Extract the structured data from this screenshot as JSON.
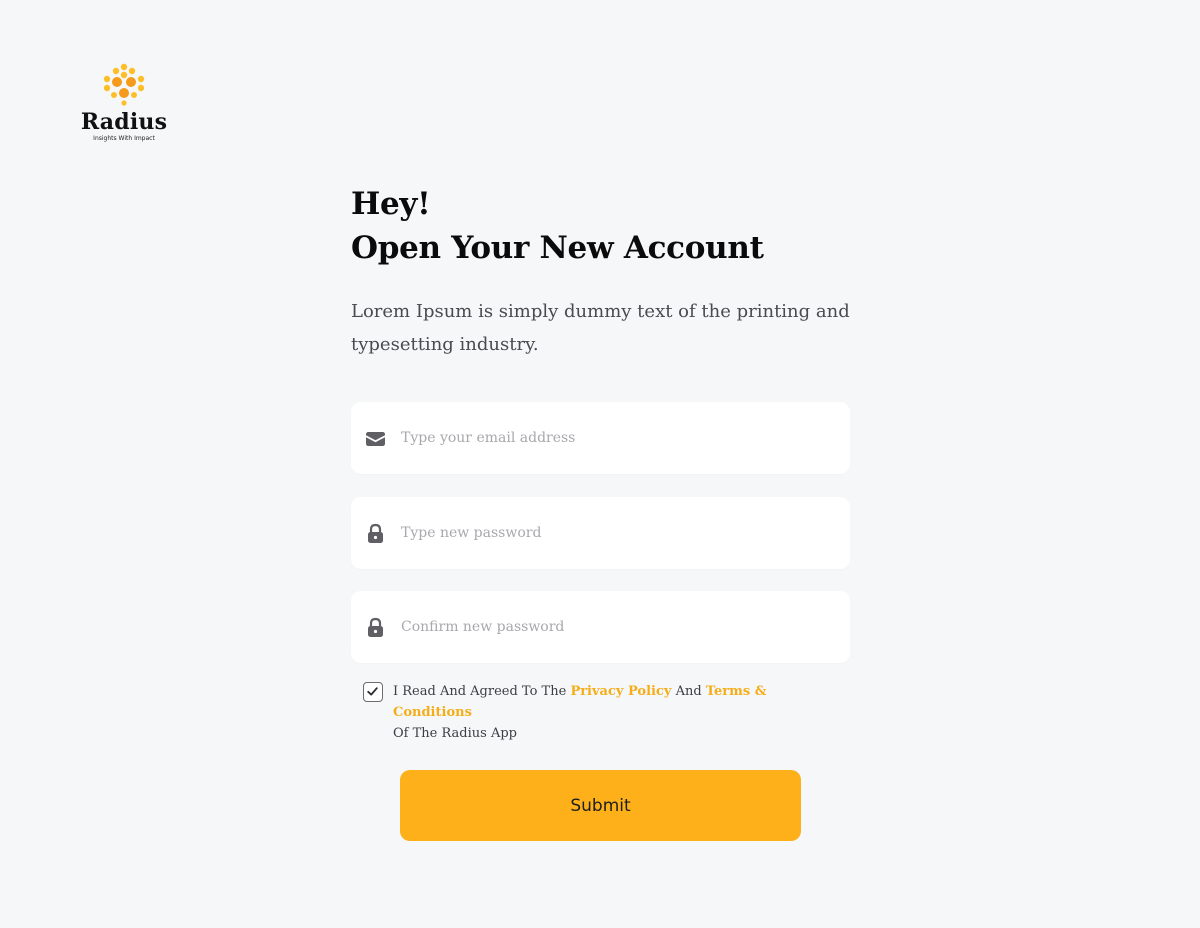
{
  "brand": {
    "name": "Radius",
    "tagline": "Insights With Impact",
    "color": "#fdb01a"
  },
  "heading": {
    "line1": "Hey!",
    "line2": "Open Your New Account"
  },
  "subtitle": "Lorem Ipsum is simply dummy text of the printing and typesetting industry.",
  "form": {
    "email": {
      "icon": "envelope-icon",
      "value": "",
      "placeholder": "Type your email address"
    },
    "password": {
      "icon": "lock-icon",
      "value": "",
      "placeholder": "Type new password"
    },
    "confirm_password": {
      "icon": "lock-icon",
      "value": "",
      "placeholder": "Confirm new password"
    },
    "agreement": {
      "checked": true,
      "prefix": "I Read And Agreed To The",
      "privacy_link": "Privacy Policy",
      "middle": "And",
      "terms_link": "Terms & Conditions",
      "suffix": "Of The Radius App",
      "link_color": "#f5ae1a"
    },
    "submit_label": "Submit"
  }
}
